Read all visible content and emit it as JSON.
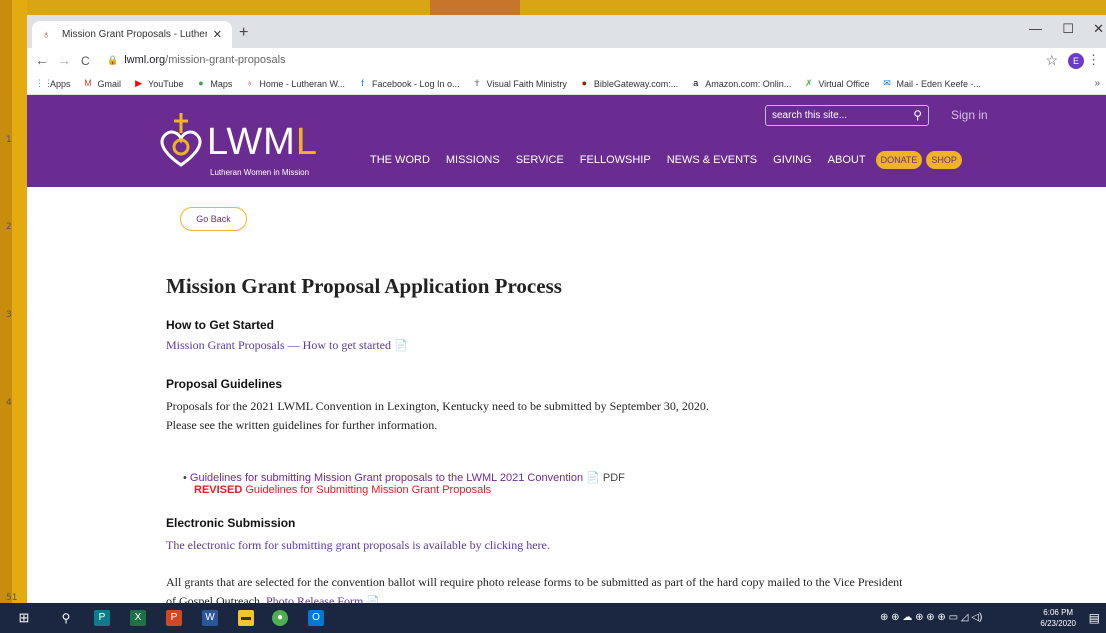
{
  "desktop": {
    "gutter_numbers": [
      "1",
      "2",
      "3",
      "4",
      "51"
    ]
  },
  "browser": {
    "tab_title": "Mission Grant Proposals - Luther",
    "tab_close": "✕",
    "new_tab": "+",
    "window_controls": {
      "minimize": "—",
      "maximize": "☐",
      "close": "✕"
    },
    "nav": {
      "back": "←",
      "forward": "→",
      "reload": "C"
    },
    "url_host": "lwml.org",
    "url_path": "/mission-grant-proposals",
    "star": "☆",
    "profile_initial": "E",
    "menu": "⋮",
    "bookmarks": [
      {
        "label": "Apps",
        "icon": "apps-grid-icon",
        "glyph": "⋮⋮",
        "color": "#4285f4"
      },
      {
        "label": "Gmail",
        "icon": "gmail-icon",
        "glyph": "M",
        "color": "#ea4335"
      },
      {
        "label": "YouTube",
        "icon": "youtube-icon",
        "glyph": "▶",
        "color": "#ff0000"
      },
      {
        "label": "Maps",
        "icon": "maps-pin-icon",
        "glyph": "●",
        "color": "#34a853"
      },
      {
        "label": "Home - Lutheran W...",
        "icon": "lwml-icon",
        "glyph": "♁",
        "color": "#c0392b"
      },
      {
        "label": "Facebook - Log In o...",
        "icon": "facebook-icon",
        "glyph": "f",
        "color": "#1877f2"
      },
      {
        "label": "Visual Faith Ministry",
        "icon": "visual-faith-icon",
        "glyph": "✝",
        "color": "#888888"
      },
      {
        "label": "BibleGateway.com:...",
        "icon": "biblegateway-icon",
        "glyph": "●",
        "color": "#8b2500"
      },
      {
        "label": "Amazon.com: Onlin...",
        "icon": "amazon-icon",
        "glyph": "a",
        "color": "#000000"
      },
      {
        "label": "Virtual Office",
        "icon": "virtual-office-icon",
        "glyph": "✗",
        "color": "#4caf50"
      },
      {
        "label": "Mail - Eden Keefe -...",
        "icon": "outlook-icon",
        "glyph": "✉",
        "color": "#0078d4"
      }
    ],
    "bookmarks_more": "»"
  },
  "site": {
    "logo_main": "LWM",
    "logo_last": "L",
    "logo_tagline": "Lutheran Women in Mission",
    "search_placeholder": "search this site...",
    "sign_in": "Sign in",
    "nav_items": [
      "THE WORD",
      "MISSIONS",
      "SERVICE",
      "FELLOWSHIP",
      "NEWS & EVENTS",
      "GIVING",
      "ABOUT"
    ],
    "donate": "DONATE",
    "shop": "SHOP",
    "brand_colors": {
      "purple": "#6b2c91",
      "gold": "#f0b323"
    }
  },
  "page": {
    "go_back": "Go Back",
    "title": "Mission Grant Proposal Application Process",
    "how_to_heading": "How to Get Started",
    "how_to_link": "Mission Grant Proposals — How to get started",
    "guidelines_heading": "Proposal Guidelines",
    "guidelines_text1": "Proposals for the 2021 LWML Convention in Lexington, Kentucky need to be submitted by September 30, 2020.",
    "guidelines_text2": "Please see the written guidelines for further information.",
    "guideline_link": "Guidelines for submitting Mission Grant proposals to the LWML 2021 Convention",
    "pdf_label": "PDF",
    "revised_bold": "REVISED",
    "revised_link": "Guidelines for Submitting Mission Grant Proposals",
    "electronic_heading": "Electronic Submission",
    "electronic_link": "The electronic form for submitting grant proposals is available by clicking here.",
    "photo_text1": "All grants that are selected for the convention ballot will require photo release forms to be submitted as part of the hard copy mailed to the Vice President",
    "photo_text2": "of Gospel Outreach.",
    "photo_link": "Photo Release Form"
  },
  "taskbar": {
    "time": "6:06 PM",
    "date": "6/23/2020"
  }
}
